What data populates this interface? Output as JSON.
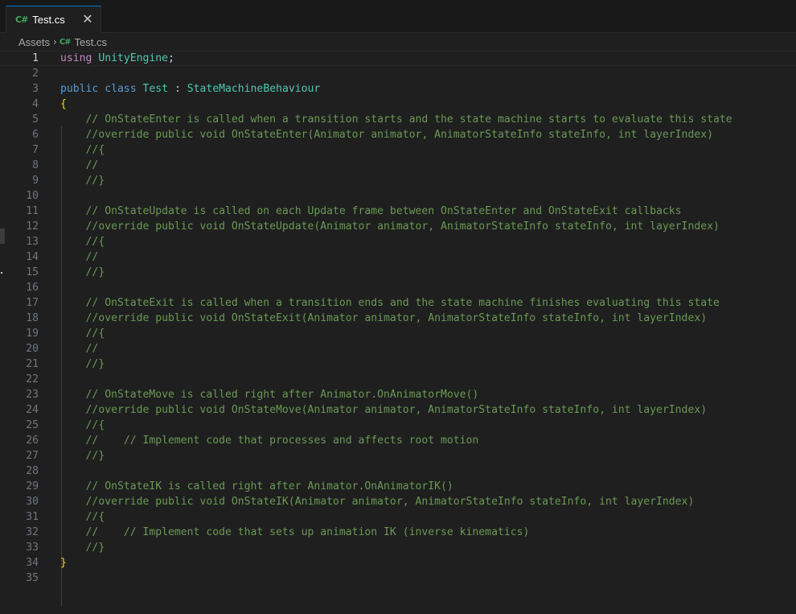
{
  "tab": {
    "icon": "C#",
    "label": "Test.cs",
    "close_glyph": "✕",
    "accent": "#0078d4"
  },
  "breadcrumb": {
    "folder": "Assets",
    "separator": "›",
    "icon": "C#",
    "file": "Test.cs"
  },
  "editor": {
    "current_line": 1,
    "lines": [
      [
        [
          "kw-using",
          "using"
        ],
        [
          "pl",
          " "
        ],
        [
          "ty",
          "UnityEngine"
        ],
        [
          "pl",
          ";"
        ]
      ],
      [],
      [
        [
          "kw",
          "public"
        ],
        [
          "pl",
          " "
        ],
        [
          "kw",
          "class"
        ],
        [
          "pl",
          " "
        ],
        [
          "ty",
          "Test"
        ],
        [
          "pl",
          " : "
        ],
        [
          "ty",
          "StateMachineBehaviour"
        ]
      ],
      [
        [
          "br",
          "{"
        ]
      ],
      [
        [
          "pl",
          "    "
        ],
        [
          "cm",
          "// OnStateEnter is called when a transition starts and the state machine starts to evaluate this state"
        ]
      ],
      [
        [
          "pl",
          "    "
        ],
        [
          "cm",
          "//override public void OnStateEnter(Animator animator, AnimatorStateInfo stateInfo, int layerIndex)"
        ]
      ],
      [
        [
          "pl",
          "    "
        ],
        [
          "cm",
          "//{"
        ]
      ],
      [
        [
          "pl",
          "    "
        ],
        [
          "cm",
          "//"
        ]
      ],
      [
        [
          "pl",
          "    "
        ],
        [
          "cm",
          "//}"
        ]
      ],
      [],
      [
        [
          "pl",
          "    "
        ],
        [
          "cm",
          "// OnStateUpdate is called on each Update frame between OnStateEnter and OnStateExit callbacks"
        ]
      ],
      [
        [
          "pl",
          "    "
        ],
        [
          "cm",
          "//override public void OnStateUpdate(Animator animator, AnimatorStateInfo stateInfo, int layerIndex)"
        ]
      ],
      [
        [
          "pl",
          "    "
        ],
        [
          "cm",
          "//{"
        ]
      ],
      [
        [
          "pl",
          "    "
        ],
        [
          "cm",
          "//"
        ]
      ],
      [
        [
          "pl",
          "    "
        ],
        [
          "cm",
          "//}"
        ]
      ],
      [],
      [
        [
          "pl",
          "    "
        ],
        [
          "cm",
          "// OnStateExit is called when a transition ends and the state machine finishes evaluating this state"
        ]
      ],
      [
        [
          "pl",
          "    "
        ],
        [
          "cm",
          "//override public void OnStateExit(Animator animator, AnimatorStateInfo stateInfo, int layerIndex)"
        ]
      ],
      [
        [
          "pl",
          "    "
        ],
        [
          "cm",
          "//{"
        ]
      ],
      [
        [
          "pl",
          "    "
        ],
        [
          "cm",
          "//"
        ]
      ],
      [
        [
          "pl",
          "    "
        ],
        [
          "cm",
          "//}"
        ]
      ],
      [],
      [
        [
          "pl",
          "    "
        ],
        [
          "cm",
          "// OnStateMove is called right after Animator.OnAnimatorMove()"
        ]
      ],
      [
        [
          "pl",
          "    "
        ],
        [
          "cm",
          "//override public void OnStateMove(Animator animator, AnimatorStateInfo stateInfo, int layerIndex)"
        ]
      ],
      [
        [
          "pl",
          "    "
        ],
        [
          "cm",
          "//{"
        ]
      ],
      [
        [
          "pl",
          "    "
        ],
        [
          "cm",
          "//    // Implement code that processes and affects root motion"
        ]
      ],
      [
        [
          "pl",
          "    "
        ],
        [
          "cm",
          "//}"
        ]
      ],
      [],
      [
        [
          "pl",
          "    "
        ],
        [
          "cm",
          "// OnStateIK is called right after Animator.OnAnimatorIK()"
        ]
      ],
      [
        [
          "pl",
          "    "
        ],
        [
          "cm",
          "//override public void OnStateIK(Animator animator, AnimatorStateInfo stateInfo, int layerIndex)"
        ]
      ],
      [
        [
          "pl",
          "    "
        ],
        [
          "cm",
          "//{"
        ]
      ],
      [
        [
          "pl",
          "    "
        ],
        [
          "cm",
          "//    // Implement code that sets up animation IK (inverse kinematics)"
        ]
      ],
      [
        [
          "pl",
          "    "
        ],
        [
          "cm",
          "//}"
        ]
      ],
      [
        [
          "br",
          "}"
        ]
      ],
      []
    ]
  }
}
